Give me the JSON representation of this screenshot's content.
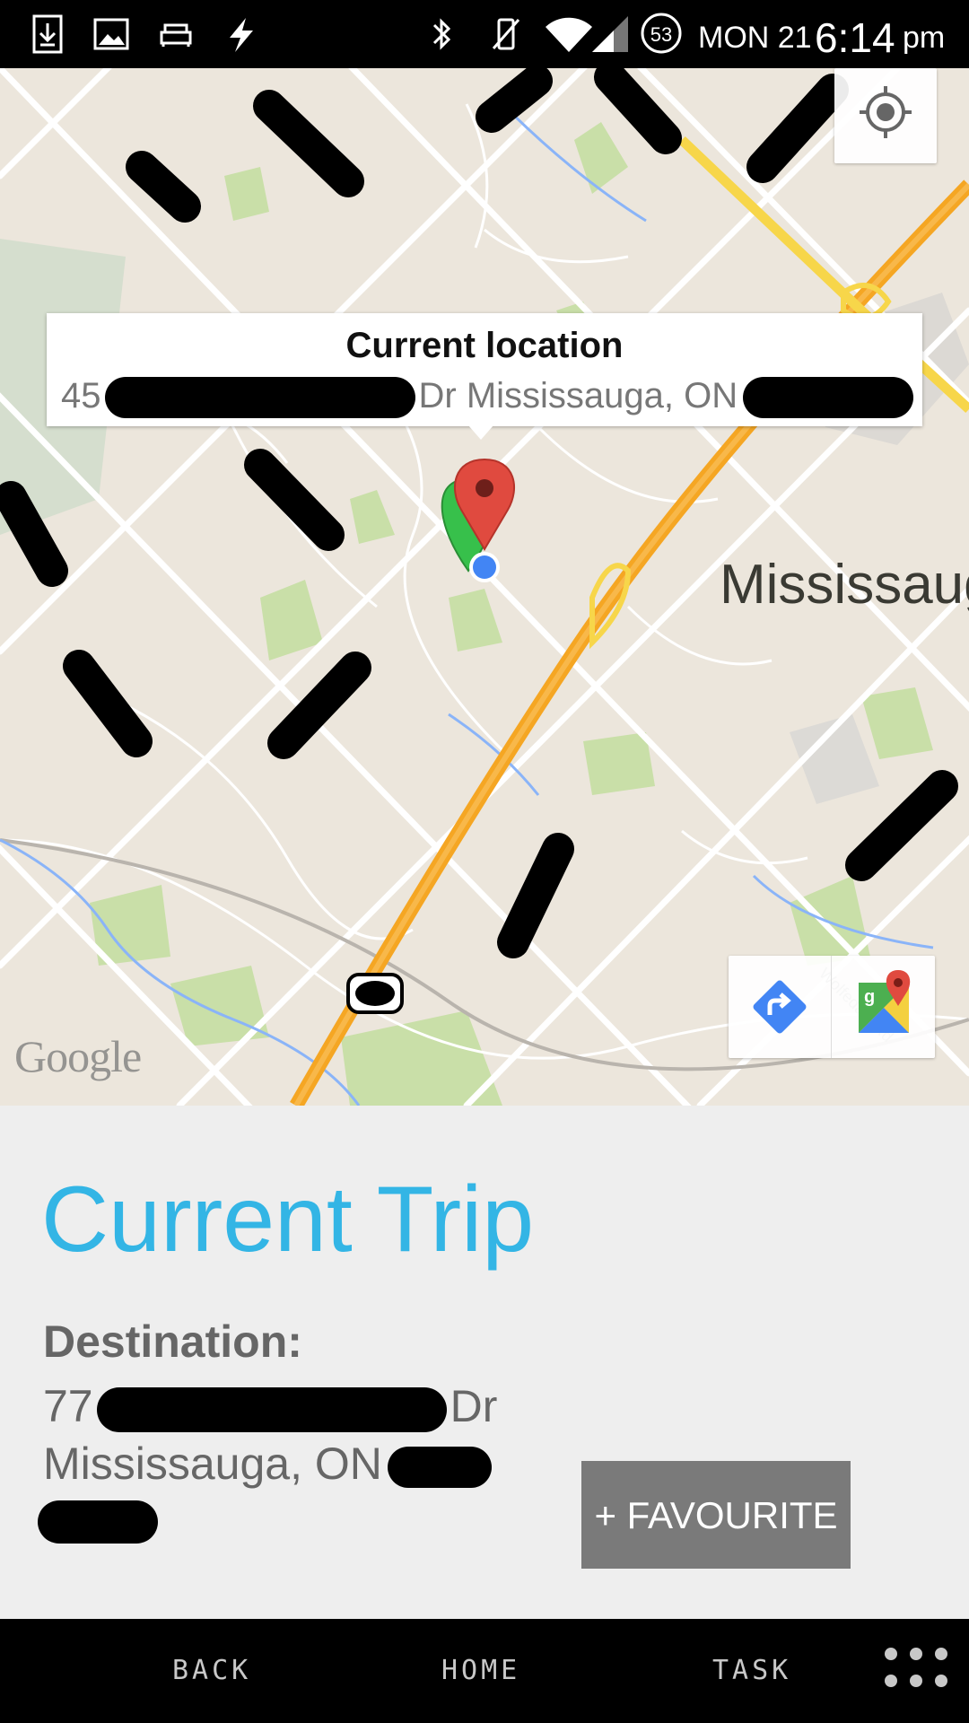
{
  "status_bar": {
    "battery": "53",
    "date": "MON 21",
    "time": "6:14",
    "ampm": "pm"
  },
  "map": {
    "callout": {
      "title": "Current location",
      "addr_start": "45",
      "addr_mid": "Dr Mississauga, ON"
    },
    "city_label": "Mississaug",
    "logo": "Google",
    "icons": {
      "my_location": "crosshair-icon",
      "directions": "directions-icon",
      "open_maps": "google-maps-icon"
    }
  },
  "trip": {
    "title": "Current Trip",
    "destination_label": "Destination:",
    "dest_line1_start": "77",
    "dest_line1_end": "Dr",
    "dest_line2": "Mississauga, ON",
    "favourite_button": "+ FAVOURITE"
  },
  "nav_bar": {
    "back": "BACK",
    "home": "HOME",
    "task": "TASK"
  },
  "colors": {
    "accent": "#33b5e5",
    "button": "#7a7a7a"
  }
}
